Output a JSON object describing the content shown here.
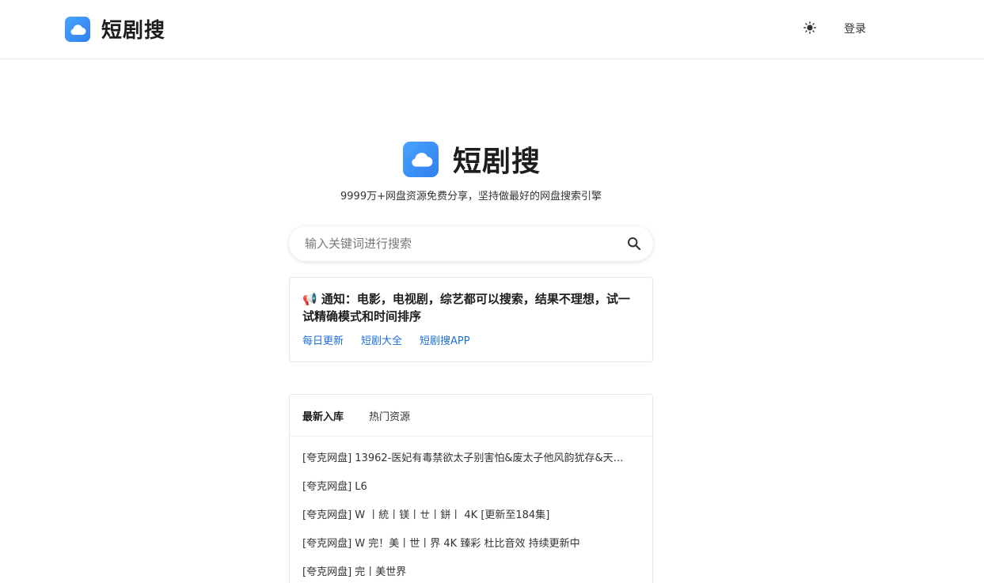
{
  "header": {
    "brand_title": "短剧搜",
    "login_label": "登录",
    "theme_icon": "sun-icon"
  },
  "hero": {
    "title": "短剧搜",
    "tagline": "9999万+网盘资源免费分享，坚持做最好的网盘搜索引擎"
  },
  "search": {
    "placeholder": "输入关键词进行搜索",
    "value": "",
    "icon": "search-icon"
  },
  "notice": {
    "icon": "megaphone-icon",
    "text": "📢 通知：电影，电视剧，综艺都可以搜索，结果不理想，试一试精确模式和时间排序",
    "links": [
      "每日更新",
      "短剧大全",
      "短剧搜APP"
    ]
  },
  "list": {
    "tabs": [
      {
        "label": "最新入库",
        "active": true
      },
      {
        "label": "热门资源",
        "active": false
      }
    ],
    "items": [
      "[夸克网盘] 13962-医妃有毒禁欲太子别害怕&废太子他风韵犹存&天…",
      "[夸克网盘] L6",
      "[夸克网盘] W 丨統丨镁丨ㄝ丨鉼丨 4K [更新至184集]",
      "[夸克网盘] W 完！美丨世丨界 4K 臻彩 杜比音效 持续更新中",
      "[夸克网盘] 完丨美世界"
    ]
  },
  "colors": {
    "accent": "#2f80ed",
    "link": "#1d6fd6",
    "border": "#e8e8e8"
  }
}
